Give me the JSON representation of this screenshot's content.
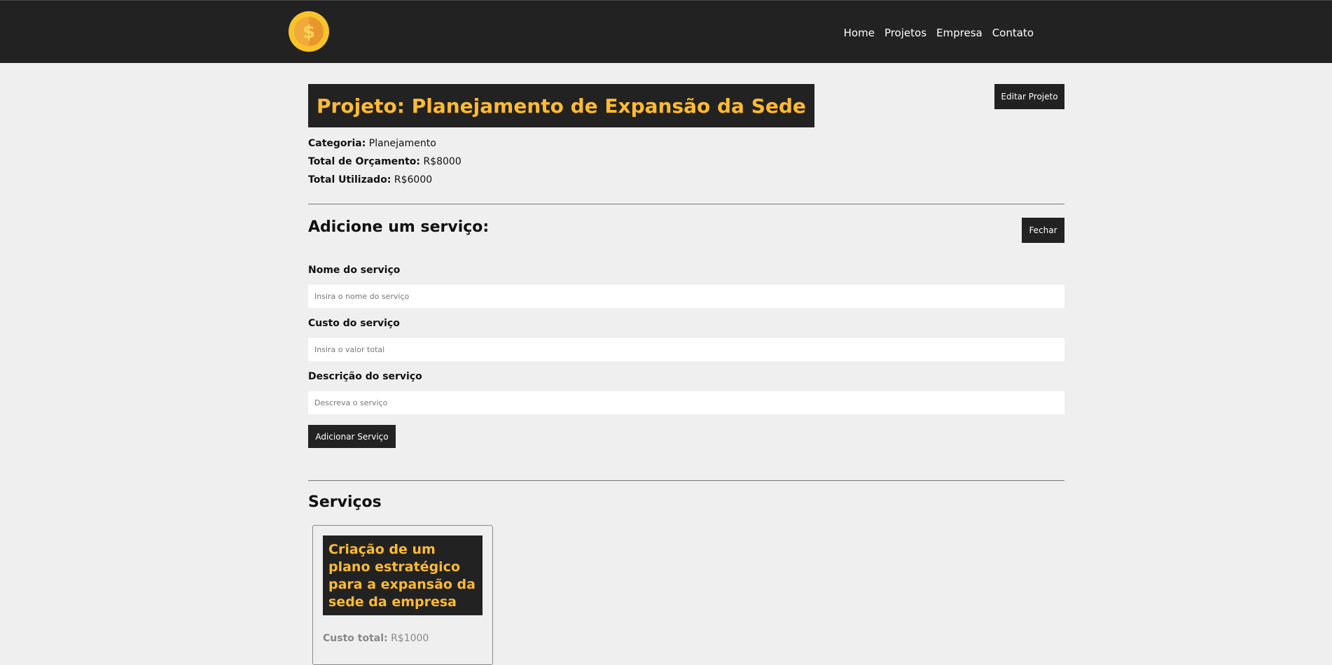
{
  "navbar": {
    "logo_icon": "coin-dollar-icon",
    "links": [
      "Home",
      "Projetos",
      "Empresa",
      "Contato"
    ]
  },
  "project": {
    "title": "Projeto: Planejamento de Expansão da Sede",
    "edit_button": "Editar Projeto",
    "category_label": "Categoria:",
    "category_value": "Planejamento",
    "budget_label": "Total de Orçamento:",
    "budget_value": "R$8000",
    "used_label": "Total Utilizado:",
    "used_value": "R$6000"
  },
  "service_form": {
    "heading": "Adicione um serviço:",
    "close_button": "Fechar",
    "name_label": "Nome do serviço",
    "name_placeholder": "Insira o nome do serviço",
    "cost_label": "Custo do serviço",
    "cost_placeholder": "Insira o valor total",
    "description_label": "Descrição do serviço",
    "description_placeholder": "Descreva o serviço",
    "submit_button": "Adicionar Serviço"
  },
  "services": {
    "heading": "Serviços",
    "items": [
      {
        "title": "Criação de um plano estratégico para a expansão da sede da empresa",
        "cost_label": "Custo total:",
        "cost_value": "R$1000"
      }
    ]
  },
  "colors": {
    "accent": "#ffbb33",
    "dark": "#222222",
    "background": "#efefef"
  }
}
